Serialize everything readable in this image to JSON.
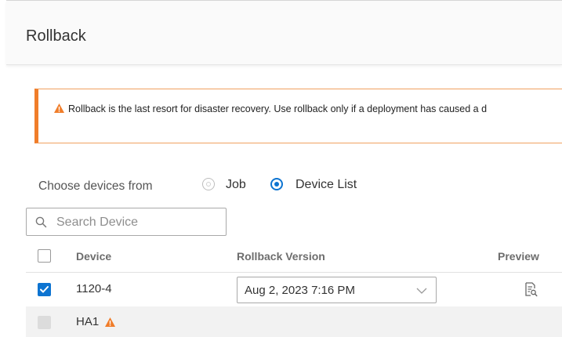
{
  "header": {
    "title": "Rollback"
  },
  "alert": {
    "icon": "warning-icon",
    "message": "Rollback is the last resort for disaster recovery. Use rollback only if a deployment has caused a d",
    "accent_color": "#f07d2a"
  },
  "device_source": {
    "label": "Choose devices from",
    "options": [
      {
        "label": "Job",
        "selected": false
      },
      {
        "label": "Device List",
        "selected": true
      }
    ]
  },
  "search": {
    "placeholder": "Search Device",
    "value": ""
  },
  "table": {
    "columns": [
      "Device",
      "Rollback Version",
      "Preview"
    ],
    "rows": [
      {
        "device": "1120-4",
        "checked": true,
        "rollback_version": "Aug 2, 2023 7:16 PM",
        "preview_icon": "preview-document-icon"
      },
      {
        "device": "HA1",
        "checked": false,
        "disabled": true,
        "status_icon": "warning-icon"
      }
    ]
  },
  "colors": {
    "primary": "#0d74d1",
    "warning": "#f07d2a"
  }
}
